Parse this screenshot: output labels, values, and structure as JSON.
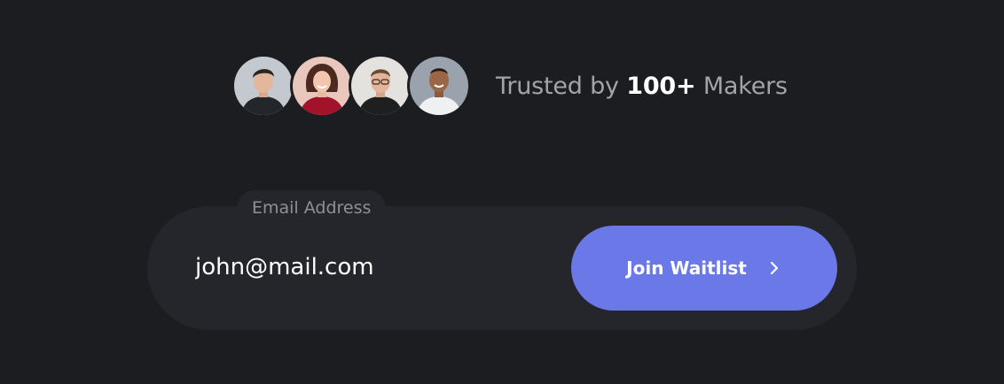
{
  "social_proof": {
    "prefix": "Trusted by",
    "count": "100+",
    "suffix": "Makers",
    "avatars": [
      {
        "name": "user-avatar-1"
      },
      {
        "name": "user-avatar-2"
      },
      {
        "name": "user-avatar-3"
      },
      {
        "name": "user-avatar-4"
      }
    ]
  },
  "form": {
    "field_label": "Email Address",
    "email_value": "john@mail.com",
    "submit_label": "Join Waitlist",
    "submit_icon": "chevron-right-icon"
  },
  "colors": {
    "background": "#1c1d20",
    "panel": "#24262b",
    "accent": "#6b78e8",
    "muted_text": "#a3a4a9"
  }
}
